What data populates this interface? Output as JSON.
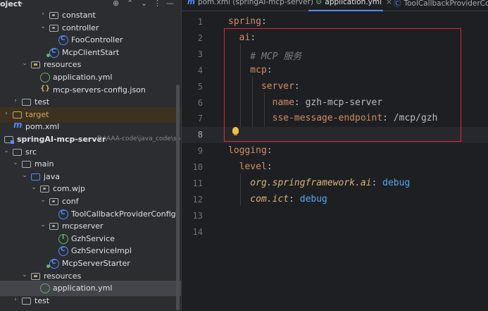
{
  "project": {
    "title": "oject",
    "tree": [
      {
        "label": "constant",
        "type": "pkg",
        "indent": 4,
        "arrow": "›"
      },
      {
        "label": "controller",
        "type": "pkg",
        "indent": 4,
        "arrow": "⌄"
      },
      {
        "label": "FooController",
        "type": "class",
        "indent": 5,
        "arrow": ""
      },
      {
        "label": "McpClientStart",
        "type": "main",
        "indent": 4,
        "arrow": ""
      },
      {
        "label": "resources",
        "type": "res",
        "indent": 2,
        "arrow": "⌄"
      },
      {
        "label": "application.yml",
        "type": "yml",
        "indent": 3,
        "arrow": ""
      },
      {
        "label": "mcp-servers-config.json",
        "type": "json",
        "indent": 3,
        "arrow": ""
      },
      {
        "label": "test",
        "type": "folder",
        "indent": 1,
        "arrow": "›"
      },
      {
        "label": "target",
        "type": "folder-orange",
        "indent": 0,
        "arrow": "›"
      },
      {
        "label": "pom.xml",
        "type": "m",
        "indent": 0,
        "arrow": ""
      },
      {
        "label": "springAI-mcp-server",
        "path": "D:\\AAA-code\\java_code\\springAI",
        "type": "module",
        "indent": -1,
        "arrow": "⌄"
      },
      {
        "label": "src",
        "type": "folder",
        "indent": 0,
        "arrow": "⌄"
      },
      {
        "label": "main",
        "type": "folder",
        "indent": 1,
        "arrow": "⌄"
      },
      {
        "label": "java",
        "type": "src",
        "indent": 2,
        "arrow": "⌄"
      },
      {
        "label": "com.wjp",
        "type": "pkg",
        "indent": 3,
        "arrow": "⌄"
      },
      {
        "label": "conf",
        "type": "pkg",
        "indent": 4,
        "arrow": "⌄"
      },
      {
        "label": "ToolCallbackProviderConfig",
        "type": "class",
        "indent": 5,
        "arrow": ""
      },
      {
        "label": "mcpserver",
        "type": "pkg",
        "indent": 4,
        "arrow": "⌄"
      },
      {
        "label": "GzhService",
        "type": "iface",
        "indent": 5,
        "arrow": ""
      },
      {
        "label": "GzhServiceImpl",
        "type": "class",
        "indent": 5,
        "arrow": ""
      },
      {
        "label": "McpServerStarter",
        "type": "main",
        "indent": 4,
        "arrow": ""
      },
      {
        "label": "resources",
        "type": "res",
        "indent": 2,
        "arrow": "⌄"
      },
      {
        "label": "application.yml",
        "type": "yml",
        "indent": 3,
        "arrow": ""
      },
      {
        "label": "test",
        "type": "folder",
        "indent": 1,
        "arrow": "›"
      }
    ]
  },
  "tabs": [
    {
      "label": "pom.xml (springAI-mcp-server)",
      "icon": "m",
      "active": false
    },
    {
      "label": "application.yml",
      "icon": "yml",
      "active": true
    },
    {
      "label": "ToolCallbackProviderConfig",
      "icon": "class",
      "active": false
    }
  ],
  "editor": {
    "lines": [
      {
        "num": "1",
        "parts": [
          {
            "t": "spring",
            "c": "k"
          },
          {
            "t": ":",
            "c": "v"
          }
        ]
      },
      {
        "num": "2",
        "parts": [
          {
            "t": "  ai",
            "c": "k"
          },
          {
            "t": ":",
            "c": "v"
          }
        ]
      },
      {
        "num": "3",
        "parts": [
          {
            "t": "    # MCP 服务",
            "c": "cm"
          }
        ]
      },
      {
        "num": "4",
        "parts": [
          {
            "t": "    mcp",
            "c": "k"
          },
          {
            "t": ":",
            "c": "v"
          }
        ]
      },
      {
        "num": "5",
        "parts": [
          {
            "t": "      server",
            "c": "k"
          },
          {
            "t": ":",
            "c": "v"
          }
        ]
      },
      {
        "num": "6",
        "parts": [
          {
            "t": "        name",
            "c": "k"
          },
          {
            "t": ": gzh-mcp-server",
            "c": "v"
          }
        ]
      },
      {
        "num": "7",
        "parts": [
          {
            "t": "        sse-message-endpoint",
            "c": "k"
          },
          {
            "t": ": /mcp/gzh",
            "c": "v"
          }
        ]
      },
      {
        "num": "8",
        "parts": []
      },
      {
        "num": "9",
        "parts": [
          {
            "t": "logging",
            "c": "k"
          },
          {
            "t": ":",
            "c": "v"
          }
        ]
      },
      {
        "num": "10",
        "parts": [
          {
            "t": "  level",
            "c": "k"
          },
          {
            "t": ":",
            "c": "v"
          }
        ]
      },
      {
        "num": "11",
        "parts": [
          {
            "t": "    org.springframework.ai",
            "c": "k2"
          },
          {
            "t": ": ",
            "c": "v"
          },
          {
            "t": "debug",
            "c": "b"
          }
        ]
      },
      {
        "num": "12",
        "parts": [
          {
            "t": "    com.ict",
            "c": "k2"
          },
          {
            "t": ": ",
            "c": "v"
          },
          {
            "t": "debug",
            "c": "b"
          }
        ]
      },
      {
        "num": "13",
        "parts": []
      },
      {
        "num": "14",
        "parts": []
      }
    ],
    "current_line": "8"
  },
  "colors": {
    "accent": "#548af7",
    "highlight_box": "#e0292f",
    "key": "#cf8e6d",
    "logger_key": "#d5b778",
    "value_keyword": "#56a8f5",
    "comment": "#7a7e85"
  }
}
